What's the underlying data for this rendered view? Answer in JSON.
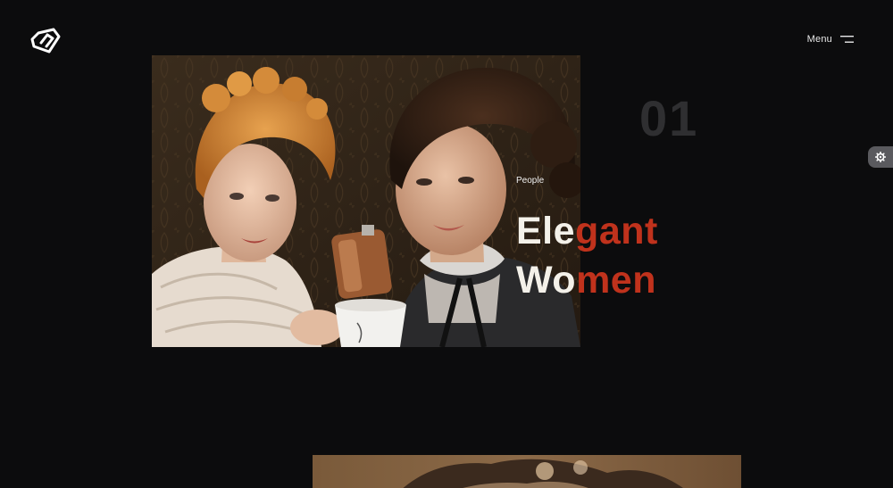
{
  "header": {
    "menu_label": "Menu",
    "logo_icon": "brand-logo-icon",
    "menu_icon": "hamburger-menu-icon"
  },
  "settings": {
    "icon": "gear-icon"
  },
  "slide": {
    "number": "01",
    "category": "People",
    "title_line1_in": "Ele",
    "title_line1_out": "gant",
    "title_line2_in": "Wo",
    "title_line2_out": "men"
  },
  "colors": {
    "background": "#0c0c0d",
    "title_inside": "#f4f1ea",
    "title_accent": "#c0321c",
    "slide_number": "#2f2f31"
  }
}
